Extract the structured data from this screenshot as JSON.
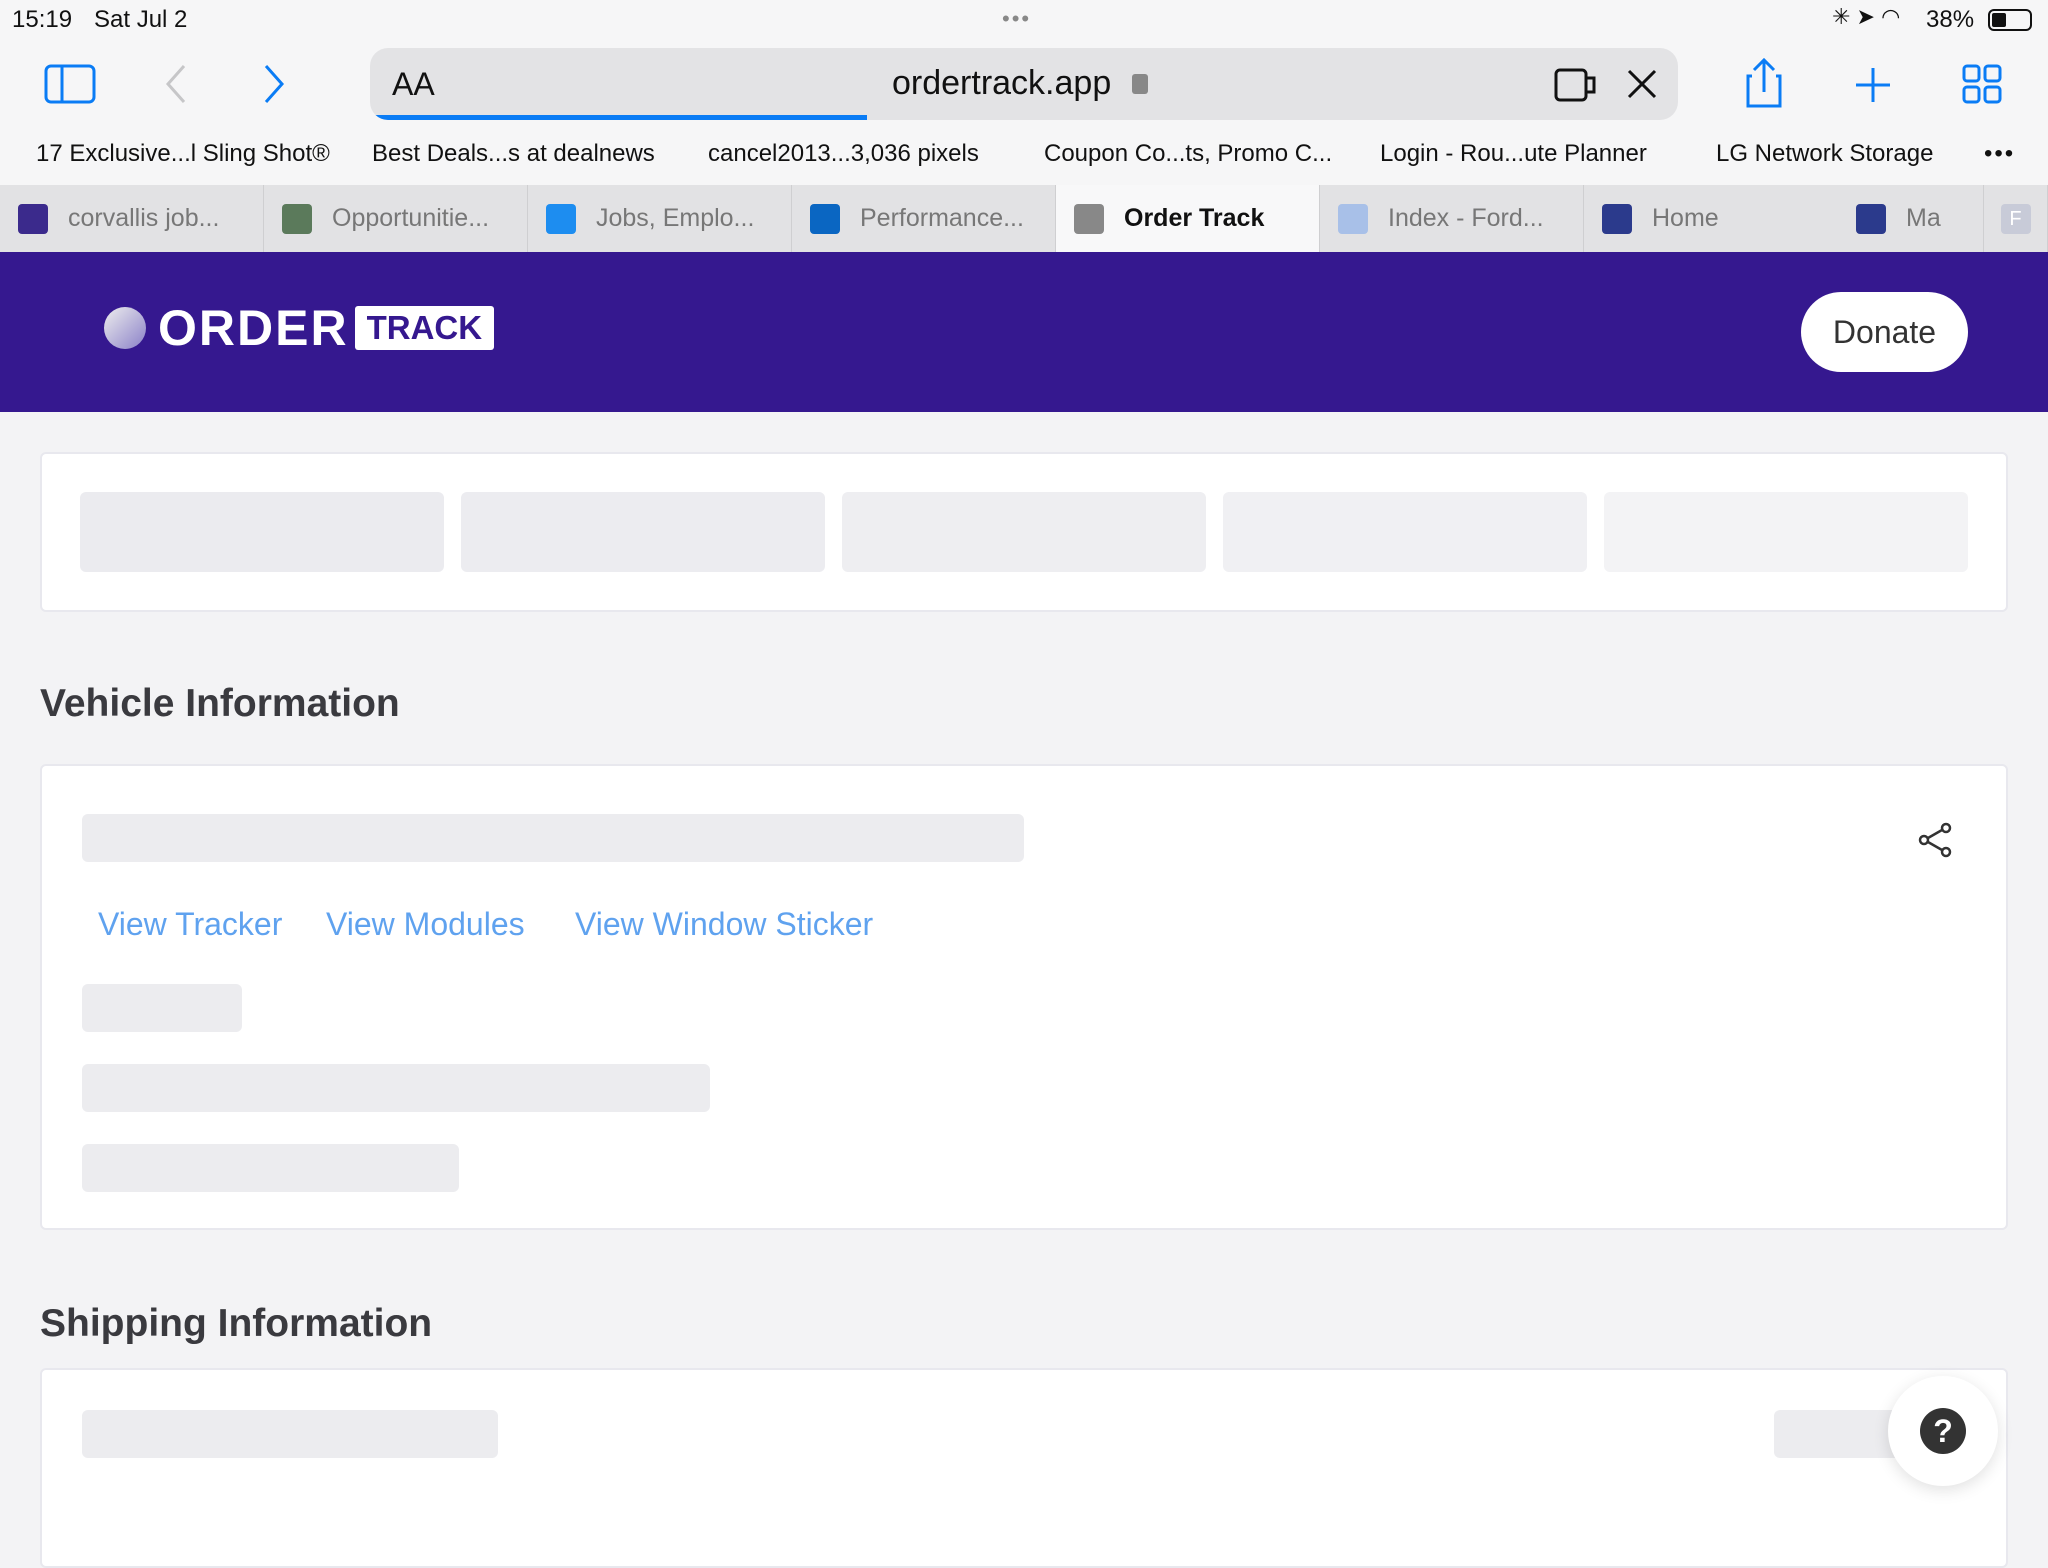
{
  "status_bar": {
    "time": "15:19",
    "date": "Sat Jul 2",
    "battery": "38%"
  },
  "browser": {
    "text_size_label": "AA",
    "url": "ordertrack.app",
    "load_progress": 0.38,
    "bookmarks": [
      "17 Exclusive...l Sling Shot®",
      "Best Deals...s at dealnews",
      "cancel2013...3,036 pixels",
      "Coupon Co...ts, Promo C...",
      "Login - Rou...ute Planner",
      "LG Network Storage"
    ],
    "tabs": [
      {
        "label": "corvallis job...",
        "icon": "peace-icon",
        "color": "#3b2a8c"
      },
      {
        "label": "Opportunitie...",
        "icon": "sheet-icon",
        "color": "#5b7a5b"
      },
      {
        "label": "Jobs, Emplo...",
        "icon": "info-icon",
        "color": "#1d8df0"
      },
      {
        "label": "Performance...",
        "icon": "linkedin-icon",
        "color": "#0a66c2"
      },
      {
        "label": "Order Track",
        "icon": "close-icon",
        "color": "#888888",
        "active": true
      },
      {
        "label": "Index - Ford...",
        "icon": "document-icon",
        "color": "#a8c0e8"
      },
      {
        "label": "Home",
        "icon": "ford-icon",
        "color": "#2b3a8c"
      },
      {
        "label": "Ma",
        "icon": "ford-icon",
        "color": "#2b3a8c"
      },
      {
        "label": "F",
        "icon": "f-icon",
        "color": "#c8cbd8"
      }
    ]
  },
  "header": {
    "logo_text": "ORDER",
    "logo_badge": "TRACK",
    "donate_label": "Donate",
    "bg": "#35188f"
  },
  "vehicle": {
    "title": "Vehicle Information",
    "links": [
      "View Tracker",
      "View Modules",
      "View Window Sticker"
    ]
  },
  "shipping": {
    "title": "Shipping Information"
  },
  "help_label": "?"
}
